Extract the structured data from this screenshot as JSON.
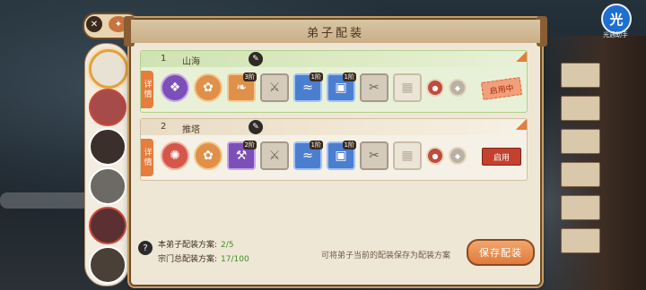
{
  "panel": {
    "title": "弟子配装"
  },
  "characters": [
    {
      "name": "char-1",
      "selected": true
    },
    {
      "name": "char-2",
      "selected": false
    },
    {
      "name": "char-3",
      "selected": false
    },
    {
      "name": "char-4",
      "selected": false
    },
    {
      "name": "char-5",
      "selected": false
    },
    {
      "name": "char-6",
      "selected": false
    }
  ],
  "configs": [
    {
      "number": "1",
      "name": "山海",
      "detail_label": "详情",
      "status_label": "启用中",
      "status": "in-use",
      "slots": [
        {
          "icon": "dragon-icon",
          "badge": ""
        },
        {
          "icon": "chest-icon",
          "badge": ""
        },
        {
          "icon": "scroll-icon",
          "badge": "3阶"
        },
        {
          "icon": "sword-icon",
          "badge": ""
        },
        {
          "icon": "fish-icon",
          "badge": "1阶"
        },
        {
          "icon": "chest-icon",
          "badge": "1阶"
        },
        {
          "icon": "blade-icon",
          "badge": ""
        },
        {
          "icon": "locked-chest-icon",
          "badge": ""
        }
      ]
    },
    {
      "number": "2",
      "name": "推塔",
      "detail_label": "详情",
      "status_label": "启用",
      "status": "enable",
      "slots": [
        {
          "icon": "phoenix-icon",
          "badge": ""
        },
        {
          "icon": "chest-icon",
          "badge": ""
        },
        {
          "icon": "hammer-icon",
          "badge": "2阶"
        },
        {
          "icon": "sword-icon",
          "badge": ""
        },
        {
          "icon": "fish-icon",
          "badge": "1阶"
        },
        {
          "icon": "chest-icon",
          "badge": "1阶"
        },
        {
          "icon": "blade-icon",
          "badge": ""
        },
        {
          "icon": "locked-chest-icon",
          "badge": ""
        }
      ]
    }
  ],
  "footer": {
    "disciple_label": "本弟子配装方案:",
    "disciple_value": "2/5",
    "sect_label": "宗门总配装方案:",
    "sect_value": "17/100",
    "hint": "可将弟子当前的配装保存为配装方案",
    "save_label": "保存配装"
  },
  "corner": {
    "glyph": "光",
    "caption": "光遇助手"
  },
  "colors": {
    "accent_orange": "#e07a3d",
    "active_row": "#e8f1d8",
    "value_green": "#3f8c2b"
  }
}
